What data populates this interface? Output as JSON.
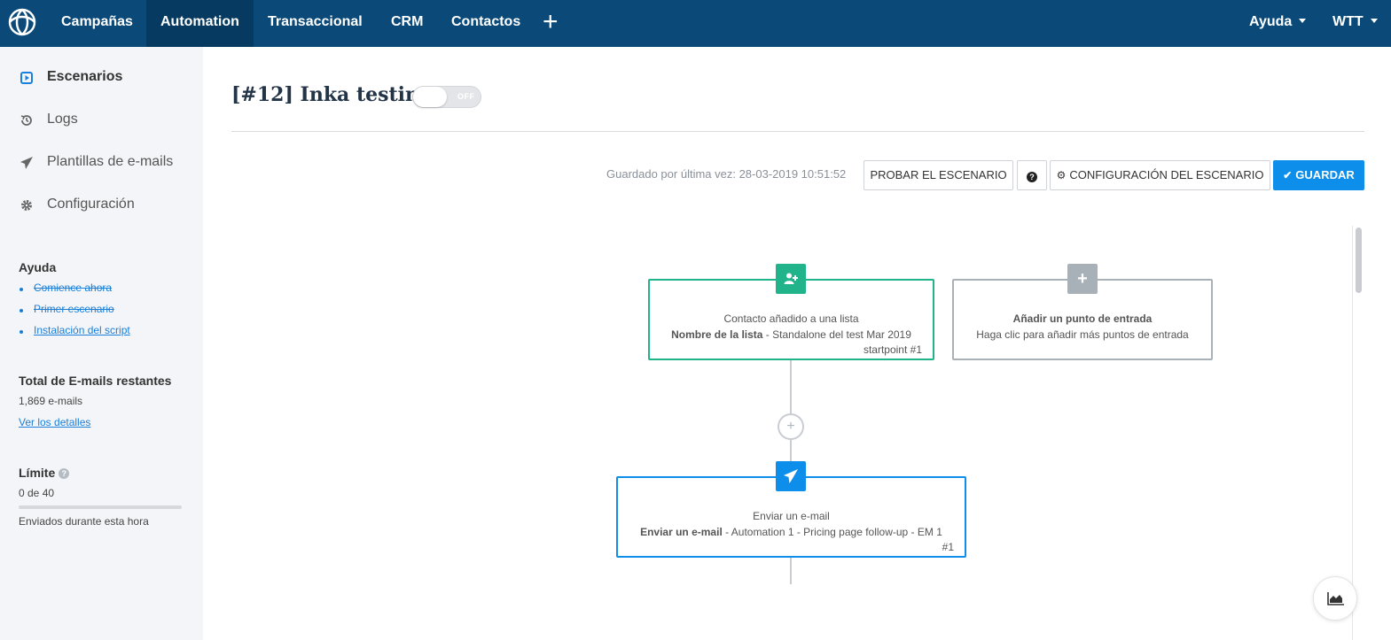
{
  "topbar": {
    "nav": [
      {
        "label": "Campañas"
      },
      {
        "label": "Automation"
      },
      {
        "label": "Transaccional"
      },
      {
        "label": "CRM"
      },
      {
        "label": "Contactos"
      }
    ],
    "plus_label": "+",
    "help_label": "Ayuda",
    "account_label": "WTT",
    "bg_color": "#0b4a78",
    "active_color": "#073a60"
  },
  "sidebar": {
    "items": [
      {
        "label": "Escenarios",
        "icon": "play-square-icon",
        "active": true
      },
      {
        "label": "Logs",
        "icon": "history-icon"
      },
      {
        "label": "Plantillas de e-mails",
        "icon": "paper-plane-icon"
      },
      {
        "label": "Configuración",
        "icon": "gear-icon"
      }
    ],
    "help": {
      "title": "Ayuda",
      "links": [
        {
          "label": "Comience ahora"
        },
        {
          "label": "Primer escenario"
        },
        {
          "label": "Instalación del script"
        }
      ]
    },
    "emails": {
      "title": "Total de E-mails restantes",
      "count": "1,869 e-mails",
      "details_link": "Ver los detalles"
    },
    "limit": {
      "title": "Límite",
      "value": "0 de 40",
      "fraction": 0,
      "caption": "Enviados durante esta hora"
    }
  },
  "main": {
    "title": "[#12] Inka testing",
    "toggle_label": "OFF",
    "saved_text": "Guardado por última vez: 28-03-2019 10:51:52",
    "buttons": {
      "test": "PROBAR EL ESCENARIO",
      "help": "?",
      "config": "CONFIGURACIÓN DEL ESCENARIO",
      "save": "GUARDAR"
    },
    "accent_color": "#0d8eea"
  },
  "workflow": {
    "trigger": {
      "title": "Contacto añadido a una lista",
      "detail_label": "Nombre de la lista",
      "detail_value": " - Standalone del test Mar 2019",
      "id": "startpoint #1",
      "color": "#21b38a",
      "icon": "user-plus-icon"
    },
    "add_entry": {
      "title": "Añadir un punto de entrada",
      "subtitle": "Haga clic para añadir más puntos de entrada",
      "color": "#a9b1b8",
      "icon": "plus-icon"
    },
    "add_step_label": "+",
    "action": {
      "title": "Enviar un e-mail",
      "detail_label": "Enviar un e-mail",
      "detail_value": " - Automation 1 - Pricing page follow-up - EM 1",
      "id": "#1",
      "color": "#0d8eea",
      "icon": "paper-plane-icon"
    }
  }
}
